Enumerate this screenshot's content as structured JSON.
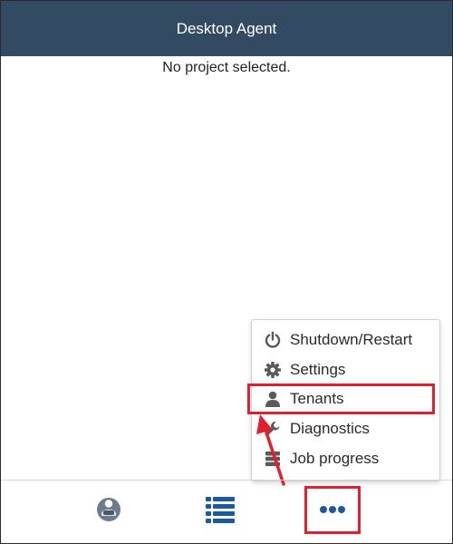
{
  "header": {
    "title": "Desktop Agent"
  },
  "main": {
    "status_text": "No project selected."
  },
  "menu": {
    "items": [
      {
        "label": "Shutdown/Restart",
        "icon": "power-icon"
      },
      {
        "label": "Settings",
        "icon": "gear-icon"
      },
      {
        "label": "Tenants",
        "icon": "user-icon",
        "highlighted": true
      },
      {
        "label": "Diagnostics",
        "icon": "wrench-icon"
      },
      {
        "label": "Job progress",
        "icon": "database-icon"
      }
    ]
  },
  "footer": {
    "tabs": [
      {
        "name": "agent-status-tab",
        "icon": "agent-icon"
      },
      {
        "name": "list-tab",
        "icon": "list-icon"
      },
      {
        "name": "more-tab",
        "icon": "more-icon",
        "highlighted": true
      }
    ]
  },
  "colors": {
    "header_bg": "#334a63",
    "accent_blue": "#1c5aa0",
    "highlight_red": "#e0202e",
    "icon_gray": "#5a5a5a"
  }
}
